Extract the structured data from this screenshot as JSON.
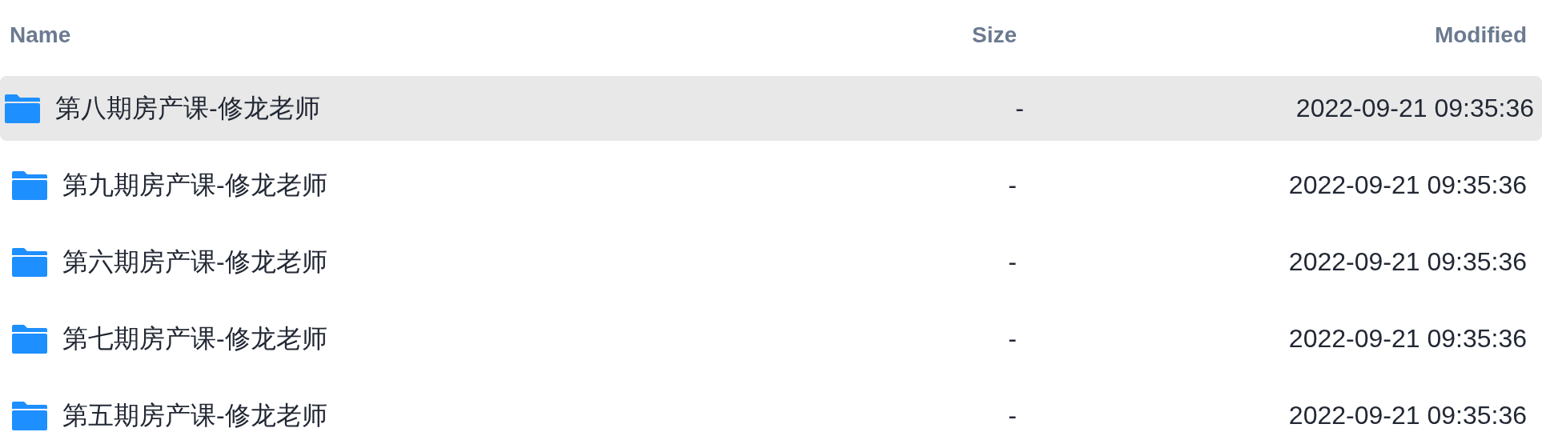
{
  "columns": [
    "Name",
    "Size",
    "Modified"
  ],
  "rows": [
    {
      "name": "第八期房产课-修龙老师",
      "size": "-",
      "modified": "2022-09-21 09:35:36",
      "selected": true
    },
    {
      "name": "第九期房产课-修龙老师",
      "size": "-",
      "modified": "2022-09-21 09:35:36",
      "selected": false
    },
    {
      "name": "第六期房产课-修龙老师",
      "size": "-",
      "modified": "2022-09-21 09:35:36",
      "selected": false
    },
    {
      "name": "第七期房产课-修龙老师",
      "size": "-",
      "modified": "2022-09-21 09:35:36",
      "selected": false
    },
    {
      "name": "第五期房产课-修龙老师",
      "size": "-",
      "modified": "2022-09-21 09:35:36",
      "selected": false
    }
  ]
}
